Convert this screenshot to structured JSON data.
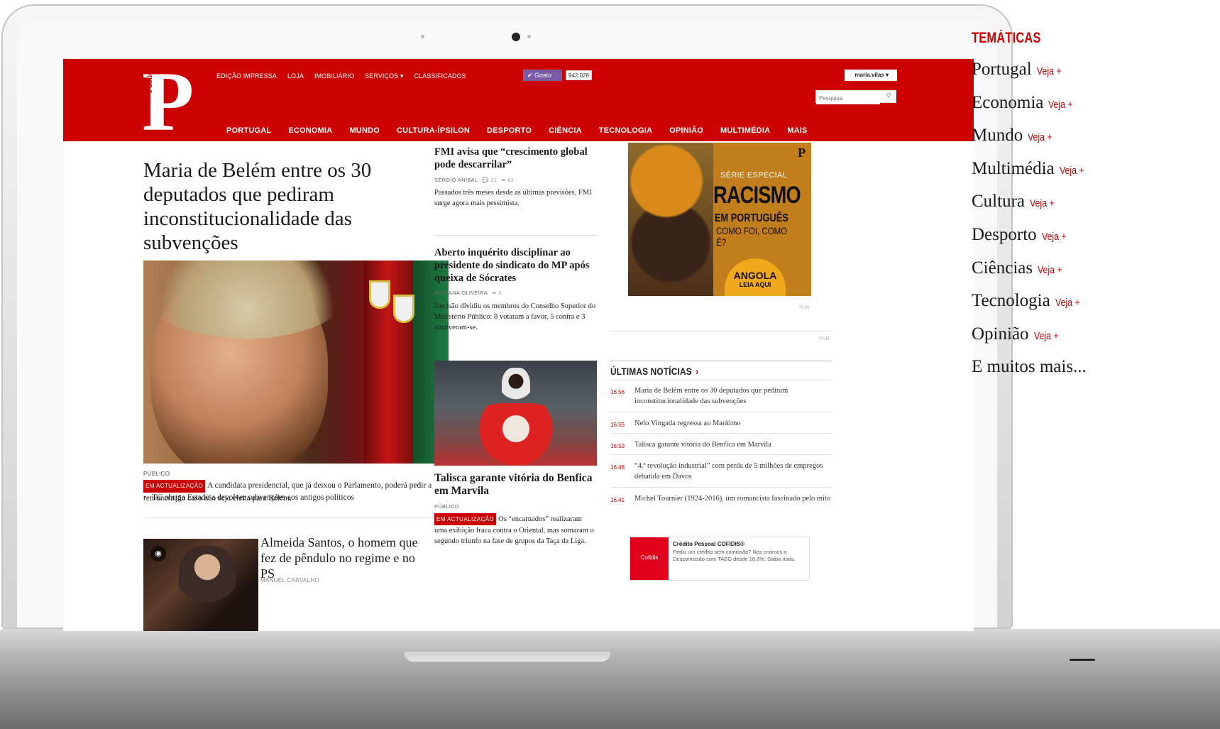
{
  "site": {
    "logo_letter": "P",
    "logo_word": "Público",
    "top_nav": [
      "EDIÇÃO IMPRESSA",
      "LOJA",
      "IMOBILIÁRIO",
      "SERVIÇOS ▾",
      "CLASSIFICADOS"
    ],
    "like_button": "✔ Gosto",
    "like_count": "942.028",
    "user_menu": "maria.vilas ▾",
    "search_placeholder": "Pesquisa",
    "main_nav": [
      "PORTUGAL",
      "ECONOMIA",
      "MUNDO",
      "CULTURA-ÍPSILON",
      "DESPORTO",
      "CIÊNCIA",
      "TECNOLOGIA",
      "OPINIÃO",
      "MULTIMÉDIA",
      "MAIS"
    ]
  },
  "lead": {
    "headline": "Maria de Belém entre os 30 deputados que pediram inconstitucionalidade das subvenções",
    "source": "PÚBLICO",
    "tag": "EM ACTUALIZAÇÃO",
    "summary": "A candidata presidencial, que já deixou o Parlamento, poderá pedir a remuneração caso não seja eleita para Belém.",
    "related": "TC obriga Estado a devolver subvenções aos antigos políticos"
  },
  "secondary": {
    "headline": "Almeida Santos, o homem que fez de pêndulo no regime e no PS",
    "byline": "MANUEL CARVALHO"
  },
  "middle": [
    {
      "title": "FMI avisa que “crescimento global pode descarrilar”",
      "byline": "SÉRGIO ANÍBAL",
      "comments": "💬 21",
      "shares": "➦ 82",
      "summary": "Passados três meses desde as últimas previsões, FMI surge agora mais pessimista."
    },
    {
      "title": "Aberto inquérito disciplinar ao presidente do sindicato do MP após queixa de Sócrates",
      "byline": "MARIANA OLIVEIRA",
      "shares": "➦ 2",
      "summary": "Decisão dividiu os membros do Conselho Superior do Ministério Público: 8 votaram a favor, 5 contra e 3 abstiveram-se."
    },
    {
      "title": "Talisca garante vitória do Benfica em Marvila",
      "byline": "PÚBLICO",
      "tag": "EM ACTUALIZAÇÃO",
      "summary": "Os “encarnados” realizaram uma exibição fraca contra o Oriental, mas somaram o segundo triunfo na fase de grupos da Taça da Liga."
    }
  ],
  "ad_racismo": {
    "brand": "P",
    "kicker": "SÉRIE ESPECIAL",
    "title": "RACISMO",
    "subtitle": "EM PORTUGUÊS",
    "question": "COMO FOI, COMO É?",
    "cta_title": "ANGOLA",
    "cta_sub": "LEIA AQUI"
  },
  "pub_label": "PUB",
  "ultimas": {
    "title": "ÚLTIMAS NOTÍCIAS",
    "chevron": "›",
    "items": [
      {
        "time": "16:56",
        "text": "Maria de Belém entre os 30 deputados que pediram inconstitucionalidade das subvenções"
      },
      {
        "time": "16:55",
        "text": "Nelo Vingada regressa ao Marítimo"
      },
      {
        "time": "16:53",
        "text": "Talisca garante vitória do Benfica em Marvila"
      },
      {
        "time": "16:48",
        "text": "“4.ª revolução industrial” com perda de 5 milhões de empregos debatida em Davos"
      },
      {
        "time": "16:41",
        "text": "Michel Tournier (1924-2016), um romancista fascinado pelo mito"
      }
    ]
  },
  "ad_cofidis": {
    "logo": "Cofidis",
    "title": "Crédito Pessoal COFIDIS®",
    "text": "Pediu um crédito sem comissão? Nós criámos a Descomissão com TAEG desde 10,6%. Saiba mais."
  },
  "tematicas": {
    "title": "TEMÁTICAS",
    "veja": "Veja +",
    "items": [
      "Portugal",
      "Economia",
      "Mundo",
      "Multimédia",
      "Cultura",
      "Desporto",
      "Ciências",
      "Tecnologia",
      "Opinião"
    ],
    "more": "E muitos mais..."
  }
}
